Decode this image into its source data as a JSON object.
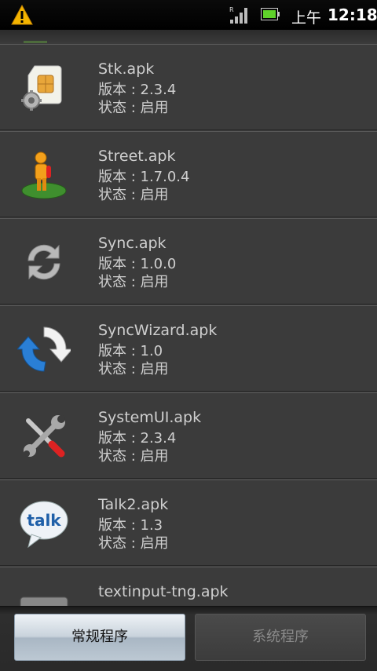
{
  "status": {
    "period": "上午",
    "time": "12:18"
  },
  "labels": {
    "version_prefix": "版本 : ",
    "state_prefix": "状态 : "
  },
  "apps": [
    {
      "name": "Stk.apk",
      "version": "版本 : 2.3.4",
      "state": "状态 : 启用",
      "icon": "sim-card-gear-icon"
    },
    {
      "name": "Street.apk",
      "version": "版本 : 1.7.0.4",
      "state": "状态 : 启用",
      "icon": "street-view-pegman-icon"
    },
    {
      "name": "Sync.apk",
      "version": "版本 : 1.0.0",
      "state": "状态 : 启用",
      "icon": "sync-arrows-icon"
    },
    {
      "name": "SyncWizard.apk",
      "version": "版本 : 1.0",
      "state": "状态 : 启用",
      "icon": "sync-wizard-icon"
    },
    {
      "name": "SystemUI.apk",
      "version": "版本 : 2.3.4",
      "state": "状态 : 启用",
      "icon": "wrench-screwdriver-icon"
    },
    {
      "name": "Talk2.apk",
      "version": "版本 : 1.3",
      "state": "状态 : 启用",
      "icon": "talk-bubble-icon"
    },
    {
      "name": "textinput-tng.apk",
      "version": "",
      "state": "",
      "icon": "keyboard-icon"
    }
  ],
  "buttons": {
    "regular": "常规程序",
    "system": "系统程序"
  }
}
